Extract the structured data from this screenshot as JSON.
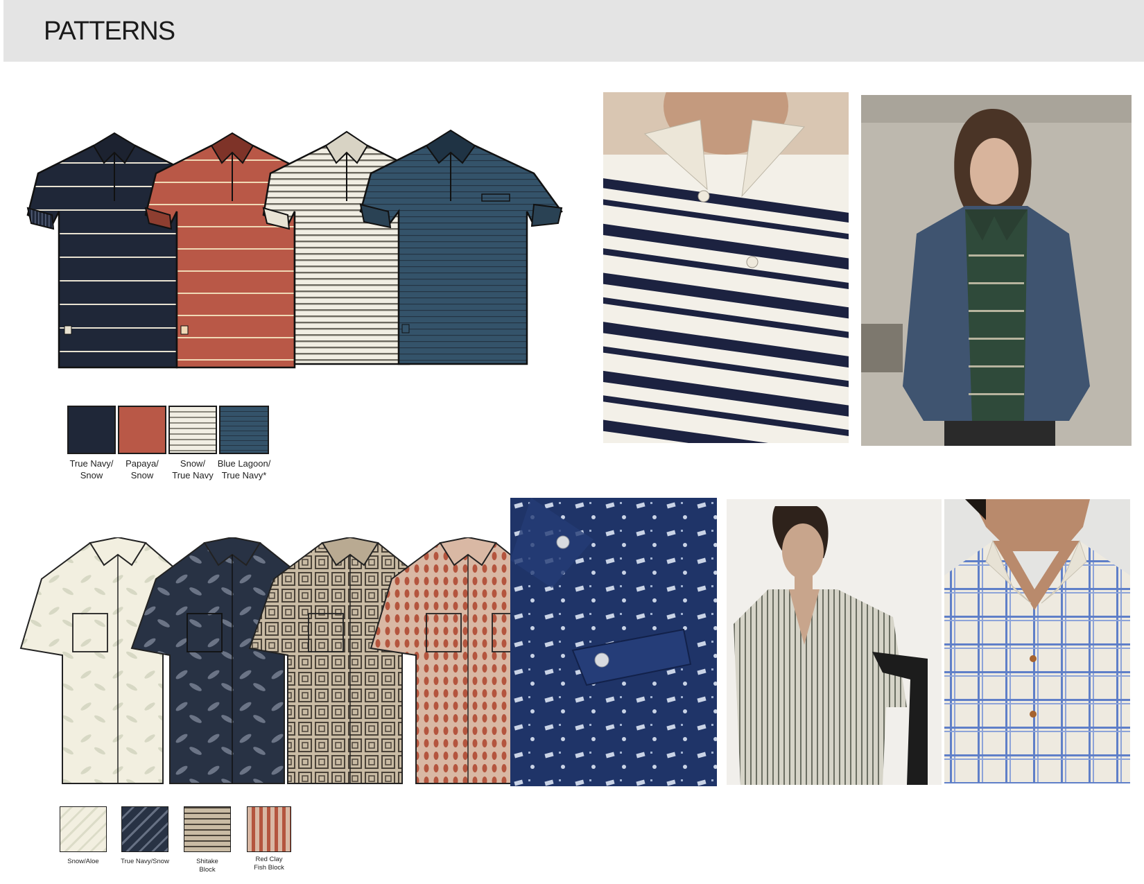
{
  "page": {
    "title": "PATTERNS"
  },
  "polo_colorways": [
    {
      "line1": "True Navy/",
      "line2": "Snow",
      "base": "#1f2738",
      "stripe": "#e9e3d2"
    },
    {
      "line1": "Papaya/",
      "line2": "Snow",
      "base": "#b95847",
      "stripe": "#f0d9b6"
    },
    {
      "line1": "Snow/",
      "line2": "True Navy",
      "base": "#f1eee3",
      "stripe": "#6d6a60"
    },
    {
      "line1": "Blue Lagoon/",
      "line2": "True Navy*",
      "base": "#34536a",
      "stripe": "#243443"
    }
  ],
  "shirt_colorways": [
    {
      "line1": "Snow/Aloe",
      "line2": "",
      "base": "#f2efe0",
      "motif": "#d7d8c4"
    },
    {
      "line1": "True Navy/Snow",
      "line2": "",
      "base": "#283244",
      "motif": "#6b7486"
    },
    {
      "line1": "Shitake",
      "line2": "Block",
      "base": "#c9bba4",
      "motif": "#4a4238"
    },
    {
      "line1": "Red Clay",
      "line2": "Fish Block",
      "base": "#d9b8a4",
      "motif": "#b4553e"
    }
  ],
  "colors": {
    "header_bg": "#e4e4e4",
    "outline": "#1b1b1b",
    "denim_print": "#1f3468"
  }
}
